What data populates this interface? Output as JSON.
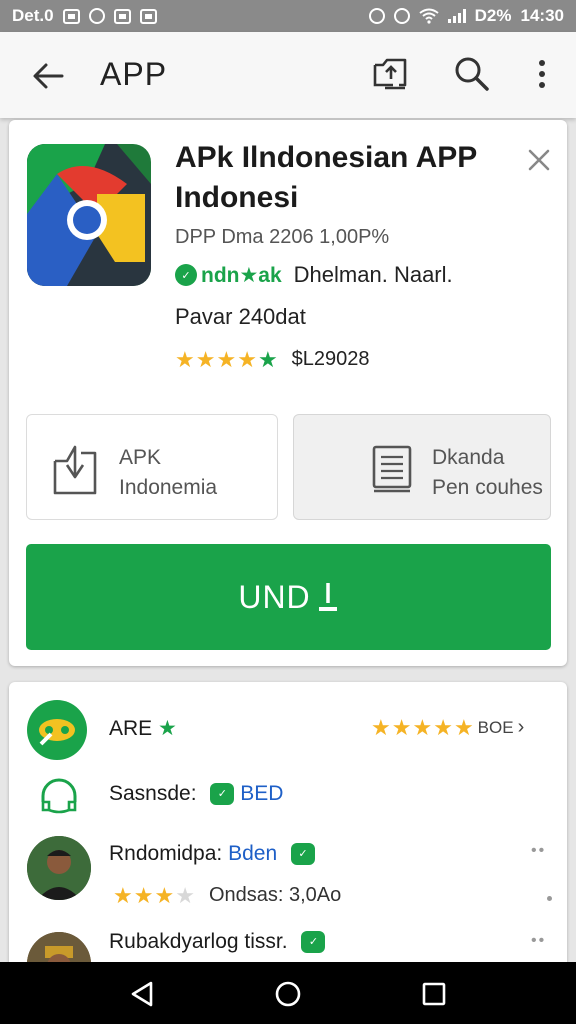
{
  "status_bar": {
    "left_text": "Det.0",
    "battery": "D2%",
    "time": "14:30"
  },
  "appbar": {
    "title": "APP",
    "icons": [
      "back-arrow-icon",
      "share-icon",
      "search-icon",
      "more-vert-icon"
    ]
  },
  "app": {
    "title": "APk Ilndonesian APP Indonesi",
    "meta_line": "DPP Dma 2206 1,00P%",
    "badge_text": "ndn★ak",
    "badge_desc": "Dhelman. Naarl.",
    "meta_line2": "Pavar 240dat",
    "rating_stars": 5,
    "price": "$L29028"
  },
  "options": {
    "left": {
      "line1": "APK",
      "line2": "Indonemia"
    },
    "right": {
      "line1": "Dkanda",
      "line2": "Pen couhes"
    }
  },
  "install_button": {
    "label": "UND"
  },
  "reviews": {
    "header_title": "ARE",
    "header_stars": 5,
    "header_link": "BOE",
    "row2_label": "Sasnsde:",
    "row2_tag": "BED",
    "row3_name": "Rndomidpa:",
    "row3_tag": "Bden",
    "row3_stars": 3,
    "row3_stats": "Ondsas: 3,0Ao",
    "row4_name": "Rubakdyarlog tissr."
  },
  "colors": {
    "primary_green": "#1aa34a",
    "star_gold": "#f5b325",
    "status_bar": "#8a8a8a",
    "link_blue": "#1e5fc7"
  }
}
